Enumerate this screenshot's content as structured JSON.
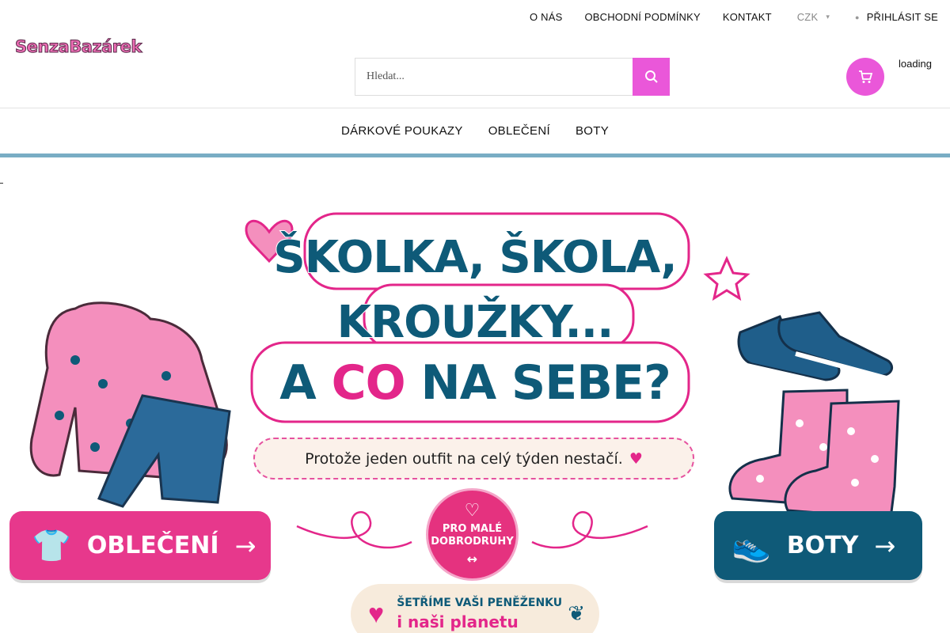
{
  "topbar": {
    "links": [
      "O NÁS",
      "OBCHODNÍ PODMÍNKY",
      "KONTAKT"
    ],
    "currency": "CZK",
    "login": "PŘIHLÁSIT SE"
  },
  "logo": {
    "text": "SenzaBazárek"
  },
  "search": {
    "placeholder": "Hledat..."
  },
  "cart": {
    "status": "loading"
  },
  "nav": {
    "items": [
      "DÁRKOVÉ POUKAZY",
      "OBLEČENÍ",
      "BOTY"
    ]
  },
  "banner": {
    "line1": "ŠKOLKA, ŠKOLA,",
    "line2": "KROUŽKY...",
    "line3_a": "A ",
    "line3_b": "CO",
    "line3_c": " NA SEBE?",
    "tagline": "Protože jeden outfit na celý týden nestačí.",
    "badge_line1": "PRO MALÉ",
    "badge_line2": "DOBRODRUHY",
    "cta_clothes": "OBLEČENÍ",
    "cta_shoes": "BOTY",
    "saving_line1": "ŠETŘÍME VAŠI PENĚŽENKU",
    "saving_line2": "i naši planetu"
  },
  "colors": {
    "accent": "#ea57d9",
    "nav_accent": "#79adc4",
    "brand_pink": "#e7388c",
    "brand_blue": "#0f5a78"
  },
  "icons": {
    "search": "search-icon",
    "cart": "cart-icon",
    "user": "user-icon",
    "chevron": "chevron-down-icon"
  }
}
